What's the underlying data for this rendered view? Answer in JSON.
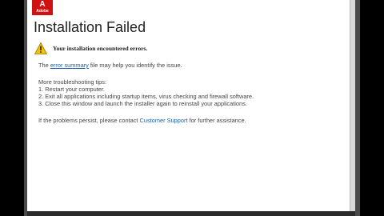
{
  "header": {
    "brand": "Adobe"
  },
  "main": {
    "title": "Installation Failed",
    "warning_message": "Your installation encountered errors.",
    "summary_prefix": "The",
    "summary_link": "error summary",
    "summary_suffix": "file may help you identify the issue.",
    "tips_heading": "More troubleshooting tips:",
    "tips": [
      "1. Restart your computer.",
      "2. Exit all applications including startup items, virus checking and firewall software.",
      "3. Close this window and launch the installer again to reinstall your applications."
    ],
    "support_prefix": "If the problems persist, please contact",
    "support_link": "Customer Support",
    "support_suffix": "for further assistance."
  },
  "colors": {
    "brand": "#cf1111",
    "link": "#1a5fa8",
    "warning": "#f2c200"
  },
  "icons": {
    "warning": "warning-triangle-icon"
  }
}
